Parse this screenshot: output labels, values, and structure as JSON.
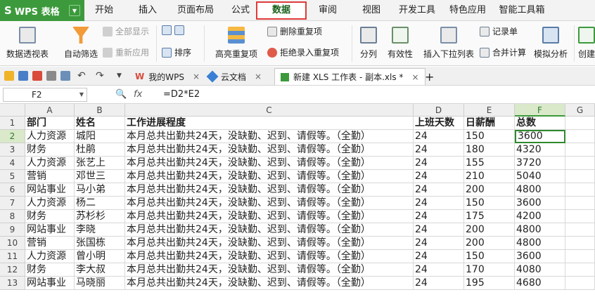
{
  "menubar": {
    "wps_label": "WPS 表格",
    "items": [
      "开始",
      "插入",
      "页面布局",
      "公式",
      "数据",
      "审阅",
      "视图",
      "开发工具",
      "特色应用",
      "智能工具箱"
    ],
    "active": "数据"
  },
  "ribbon": {
    "pivot": "数据透视表",
    "autofilter": "自动筛选",
    "show_all": "全部显示",
    "reapply": "重新应用",
    "sort": "排序",
    "highlight_dup": "高亮重复项",
    "remove_dup": "删除重复项",
    "reject_dup": "拒绝录入重复项",
    "split": "分列",
    "validity": "有效性",
    "insert_dropdown": "插入下拉列表",
    "record_sheet": "记录单",
    "merge_calc": "合并计算",
    "simulate": "模拟分析",
    "create": "创建"
  },
  "toolbar": {
    "tab_mywps": "我的WPS",
    "tab_cloud": "云文档",
    "tab_file": "新建 XLS 工作表 - 副本.xls *",
    "plus": "+"
  },
  "formulabar": {
    "cell_ref": "F2",
    "fx": "fx",
    "formula": "=D2*E2"
  },
  "grid": {
    "columns": [
      "A",
      "B",
      "C",
      "D",
      "E",
      "F",
      "G"
    ],
    "rows": [
      "1",
      "2",
      "3",
      "4",
      "5",
      "6",
      "7",
      "8",
      "9",
      "10",
      "11",
      "12",
      "13"
    ],
    "header": [
      "部门",
      "姓名",
      "工作进展程度",
      "上班天数",
      "日薪酬",
      "总数"
    ],
    "data": [
      [
        "人力资源",
        "城阳",
        "本月总共出勤共24天，没缺勤、迟到、请假等。（全勤）",
        "24",
        "150",
        "3600"
      ],
      [
        "财务",
        "杜鹃",
        "本月总共出勤共24天，没缺勤、迟到、请假等。（全勤）",
        "24",
        "180",
        "4320"
      ],
      [
        "人力资源",
        "张艺上",
        "本月总共出勤共24天，没缺勤、迟到、请假等。（全勤）",
        "24",
        "155",
        "3720"
      ],
      [
        "营销",
        "邓世三",
        "本月总共出勤共24天，没缺勤、迟到、请假等。（全勤）",
        "24",
        "210",
        "5040"
      ],
      [
        "网站事业",
        "马小弟",
        "本月总共出勤共24天，没缺勤、迟到、请假等。（全勤）",
        "24",
        "200",
        "4800"
      ],
      [
        "人力资源",
        "杨二",
        "本月总共出勤共24天，没缺勤、迟到、请假等。（全勤）",
        "24",
        "150",
        "3600"
      ],
      [
        "财务",
        "苏杉杉",
        "本月总共出勤共24天，没缺勤、迟到、请假等。（全勤）",
        "24",
        "175",
        "4200"
      ],
      [
        "网站事业",
        "李晓",
        "本月总共出勤共24天，没缺勤、迟到、请假等。（全勤）",
        "24",
        "200",
        "4800"
      ],
      [
        "营销",
        "张国栋",
        "本月总共出勤共24天，没缺勤、迟到、请假等。（全勤）",
        "24",
        "200",
        "4800"
      ],
      [
        "人力资源",
        "曾小明",
        "本月总共出勤共24天，没缺勤、迟到、请假等。（全勤）",
        "24",
        "150",
        "3600"
      ],
      [
        "财务",
        "李大叔",
        "本月总共出勤共24天，没缺勤、迟到、请假等。（全勤）",
        "24",
        "170",
        "4080"
      ],
      [
        "网站事业",
        "马晓丽",
        "本月总共出勤共24天，没缺勤、迟到、请假等。（全勤）",
        "24",
        "195",
        "4680"
      ]
    ]
  }
}
